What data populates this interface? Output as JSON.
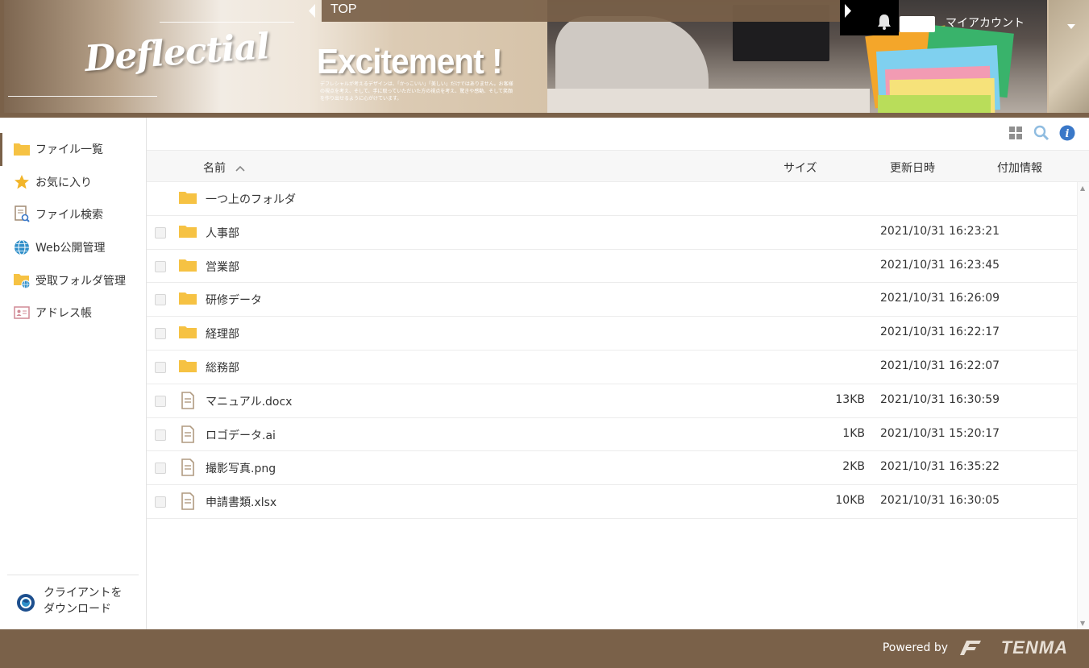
{
  "header": {
    "logo_text": "Deflectial",
    "headline": "Excitement !",
    "tagline": "デフレシャルが考えるデザインは、「かっこいい」「美しい」だけではありません。お客様の視点を考え、そして、手に取っていただいた方の視点を考え、驚きや感動、そして笑顔を作り出せるように心がけています。",
    "nav_label": "TOP",
    "account_label": "マイアカウント"
  },
  "sidebar": {
    "items": [
      {
        "label": "ファイル一覧",
        "icon": "folder-icon",
        "active": true
      },
      {
        "label": "お気に入り",
        "icon": "star-icon"
      },
      {
        "label": "ファイル検索",
        "icon": "file-search-icon"
      },
      {
        "label": "Web公開管理",
        "icon": "globe-icon"
      },
      {
        "label": "受取フォルダ管理",
        "icon": "folder-globe-icon"
      },
      {
        "label": "アドレス帳",
        "icon": "address-card-icon"
      }
    ],
    "client_download": "クライアントを\nダウンロード"
  },
  "table": {
    "columns": {
      "name": "名前",
      "size": "サイズ",
      "modified": "更新日時",
      "extra": "付加情報"
    },
    "parent_folder": "一つ上のフォルダ",
    "rows": [
      {
        "type": "folder",
        "name": "人事部",
        "size": "",
        "modified": "2021/10/31 16:23:21"
      },
      {
        "type": "folder",
        "name": "営業部",
        "size": "",
        "modified": "2021/10/31 16:23:45"
      },
      {
        "type": "folder",
        "name": "研修データ",
        "size": "",
        "modified": "2021/10/31 16:26:09"
      },
      {
        "type": "folder",
        "name": "経理部",
        "size": "",
        "modified": "2021/10/31 16:22:17"
      },
      {
        "type": "folder",
        "name": "総務部",
        "size": "",
        "modified": "2021/10/31 16:22:07"
      },
      {
        "type": "file",
        "name": "マニュアル.docx",
        "size": "13KB",
        "modified": "2021/10/31 16:30:59"
      },
      {
        "type": "file",
        "name": "ロゴデータ.ai",
        "size": "1KB",
        "modified": "2021/10/31 15:20:17"
      },
      {
        "type": "file",
        "name": "撮影写真.png",
        "size": "2KB",
        "modified": "2021/10/31 16:35:22"
      },
      {
        "type": "file",
        "name": "申請書類.xlsx",
        "size": "10KB",
        "modified": "2021/10/31 16:30:05"
      }
    ]
  },
  "footer": {
    "powered_by": "Powered by",
    "brand": "TENMA"
  },
  "colors": {
    "brand_brown": "#7a6149",
    "folder_yellow": "#f6c243",
    "file_icon": "#b09a80",
    "info_blue": "#3a78c8"
  }
}
